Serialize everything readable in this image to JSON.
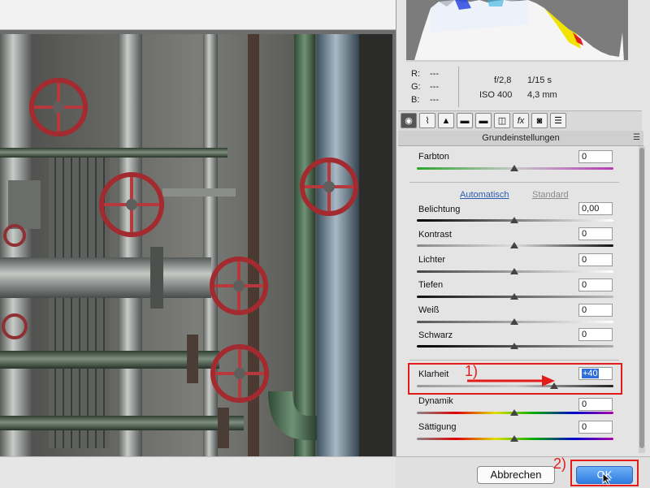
{
  "info": {
    "r_label": "R:",
    "r_value": "---",
    "g_label": "G:",
    "g_value": "---",
    "b_label": "B:",
    "b_value": "---",
    "aperture": "f/2,8",
    "shutter": "1/15 s",
    "iso": "ISO 400",
    "focal": "4,3 mm"
  },
  "tools": [
    {
      "name": "basic-tool-icon",
      "glyph": "◉"
    },
    {
      "name": "tone-curve-icon",
      "glyph": "⌇"
    },
    {
      "name": "detail-icon",
      "glyph": "▲"
    },
    {
      "name": "hsl-icon",
      "glyph": "▬"
    },
    {
      "name": "split-toning-icon",
      "glyph": "▬"
    },
    {
      "name": "lens-icon",
      "glyph": "◫"
    },
    {
      "name": "effects-icon",
      "glyph": "fx"
    },
    {
      "name": "camera-calibration-icon",
      "glyph": "◙"
    },
    {
      "name": "presets-icon",
      "glyph": "☰"
    }
  ],
  "panel": {
    "title": "Grundeinstellungen",
    "menu_glyph": "☰"
  },
  "controls": {
    "farbton": {
      "label": "Farbton",
      "value": "0"
    },
    "auto_link": "Automatisch",
    "standard_link": "Standard",
    "belichtung": {
      "label": "Belichtung",
      "value": "0,00"
    },
    "kontrast": {
      "label": "Kontrast",
      "value": "0"
    },
    "lichter": {
      "label": "Lichter",
      "value": "0"
    },
    "tiefen": {
      "label": "Tiefen",
      "value": "0"
    },
    "weiss": {
      "label": "Weiß",
      "value": "0"
    },
    "schwarz": {
      "label": "Schwarz",
      "value": "0"
    },
    "klarheit": {
      "label": "Klarheit",
      "value": "+40"
    },
    "dynamik": {
      "label": "Dynamik",
      "value": "0"
    },
    "saettigung": {
      "label": "Sättigung",
      "value": "0"
    }
  },
  "annotations": {
    "step1": "1)",
    "step2": "2)"
  },
  "buttons": {
    "cancel": "Abbrechen",
    "ok": "OK"
  },
  "colors": {
    "annotation_red": "#e31b1b",
    "ok_blue": "#2f7de3",
    "link_blue": "#2a5db0"
  }
}
